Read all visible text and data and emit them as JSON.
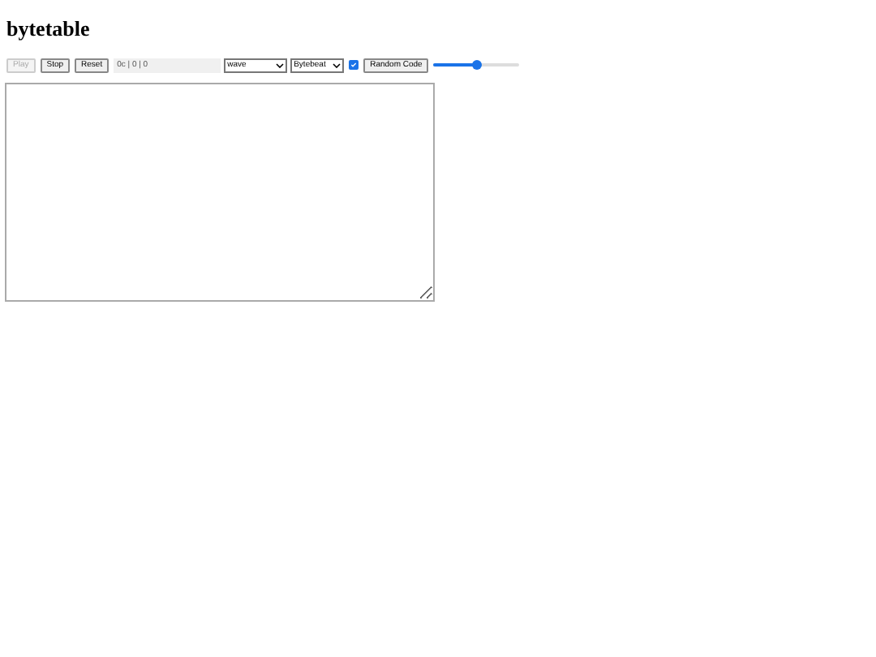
{
  "title": "bytetable",
  "buttons": [
    {
      "label": "Play",
      "disabled": true
    },
    {
      "label": "Stop",
      "disabled": false
    },
    {
      "label": "Reset",
      "disabled": false
    }
  ],
  "status": {
    "value": "0c | 0 | 0"
  },
  "selects": [
    {
      "value": "wave"
    },
    {
      "value": "Bytebeat"
    }
  ],
  "checkbox": {
    "checked": true
  },
  "random_button": {
    "label": "Random Code"
  },
  "slider": {
    "level": 0.5
  }
}
